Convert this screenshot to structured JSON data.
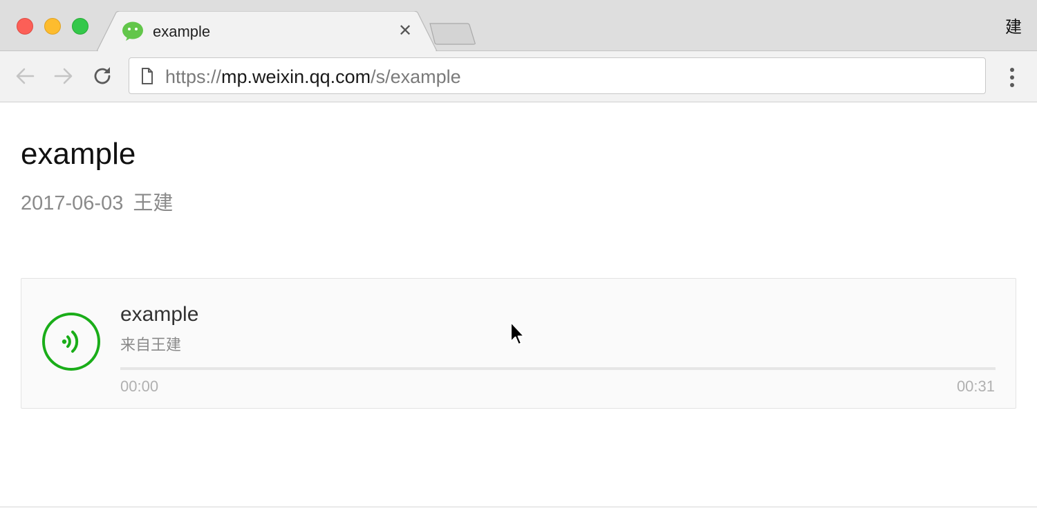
{
  "browser": {
    "tab": {
      "title": "example",
      "favicon": "wechat-icon",
      "close_glyph": "✕"
    },
    "profile_label": "建",
    "address": {
      "scheme": "https://",
      "host": "mp.weixin.qq.com",
      "path": "/s/example"
    }
  },
  "article": {
    "title": "example",
    "date": "2017-06-03",
    "author": "王建"
  },
  "audio": {
    "title": "example",
    "source": "来自王建",
    "elapsed": "00:00",
    "duration": "00:31",
    "progress": 0,
    "icon": "audio-wave-icon"
  },
  "colors": {
    "accent_green": "#1aad19",
    "tabstrip": "#dedede",
    "toolbar": "#f2f2f2"
  }
}
